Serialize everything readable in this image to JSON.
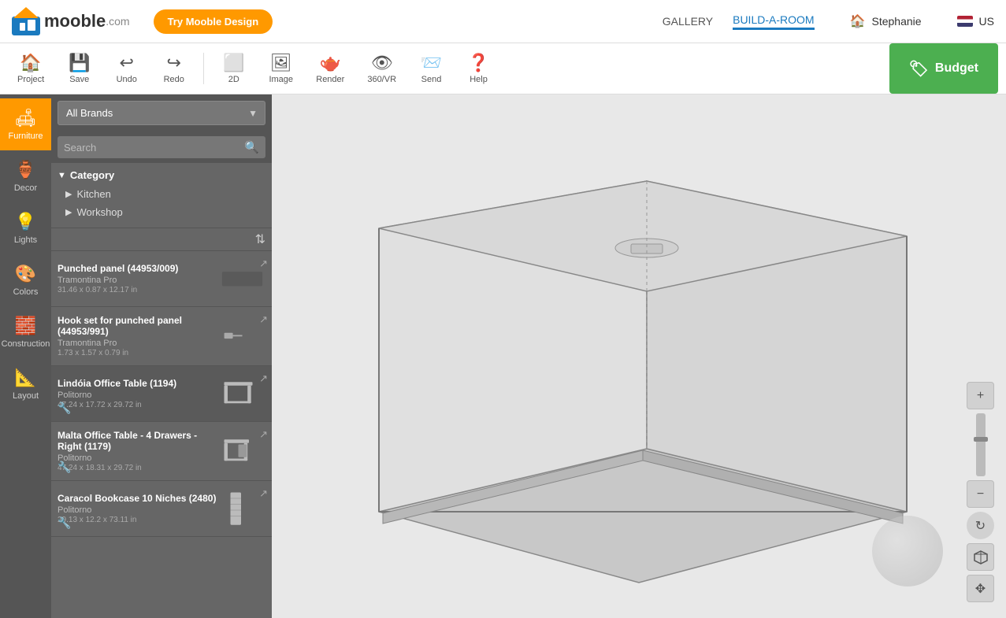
{
  "app": {
    "name": "mooble",
    "domain": ".com"
  },
  "topnav": {
    "try_btn": "Try Mooble Design",
    "gallery": "GALLERY",
    "build_a_room": "BUILD-A-ROOM",
    "user": "Stephanie",
    "country": "US"
  },
  "toolbar": {
    "project": "Project",
    "save": "Save",
    "undo": "Undo",
    "redo": "Redo",
    "twod": "2D",
    "image": "Image",
    "render": "Render",
    "vr": "360/VR",
    "send": "Send",
    "help": "Help",
    "budget": "Budget"
  },
  "sidebar": {
    "items": [
      {
        "id": "furniture",
        "label": "Furniture",
        "icon": "🛋"
      },
      {
        "id": "decor",
        "label": "Decor",
        "icon": "🏺"
      },
      {
        "id": "lights",
        "label": "Lights",
        "icon": "💡"
      },
      {
        "id": "colors",
        "label": "Colors",
        "icon": "🎨"
      },
      {
        "id": "construction",
        "label": "Construction",
        "icon": "🧱"
      },
      {
        "id": "layout",
        "label": "Layout",
        "icon": "📐"
      }
    ]
  },
  "panel": {
    "brand_placeholder": "All Brands",
    "search_placeholder": "Search",
    "category_label": "Category",
    "category_items": [
      {
        "label": "Kitchen"
      },
      {
        "label": "Workshop"
      }
    ],
    "products": [
      {
        "name": "Punched panel (44953/009)",
        "brand": "Tramontina Pro",
        "size": "31.46 x 0.87 x 12.17 in"
      },
      {
        "name": "Hook set for punched panel (44953/991)",
        "brand": "Tramontina Pro",
        "size": "1.73 x 1.57 x 0.79 in"
      },
      {
        "name": "Lindóia Office Table (1194)",
        "brand": "Politorno",
        "size": "47.24 x 17.72 x 29.72 in"
      },
      {
        "name": "Malta Office Table - 4 Drawers - Right (1179)",
        "brand": "Politorno",
        "size": "47.24 x 18.31 x 29.72 in"
      },
      {
        "name": "Caracol Bookcase 10 Niches (2480)",
        "brand": "Politorno",
        "size": "29.13 x 12.2 x 73.11 in"
      }
    ]
  }
}
